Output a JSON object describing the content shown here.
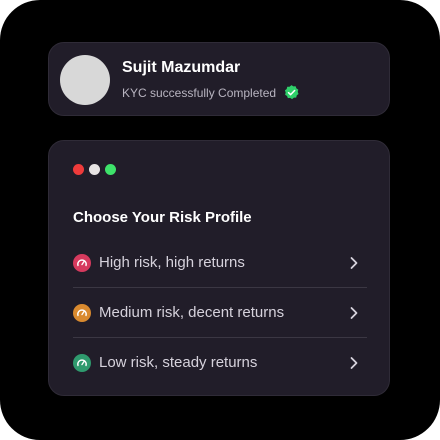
{
  "profile": {
    "name": "Sujit Mazumdar",
    "kyc_status": "KYC successfully Completed",
    "verified_icon": "verified-check-icon",
    "verified_color": "#2fd06a"
  },
  "risk_profile": {
    "title": "Choose Your Risk Profile",
    "window_dots": [
      "#ef3b3b",
      "#e8e4e4",
      "#3ee26a"
    ],
    "options": [
      {
        "label": "High risk, high returns",
        "icon": "speedometer-icon",
        "color": "#d63a5e"
      },
      {
        "label": "Medium risk, decent returns",
        "icon": "speedometer-icon",
        "color": "#d98a2f"
      },
      {
        "label": "Low risk, steady returns",
        "icon": "speedometer-icon",
        "color": "#2f9a6e"
      }
    ]
  }
}
